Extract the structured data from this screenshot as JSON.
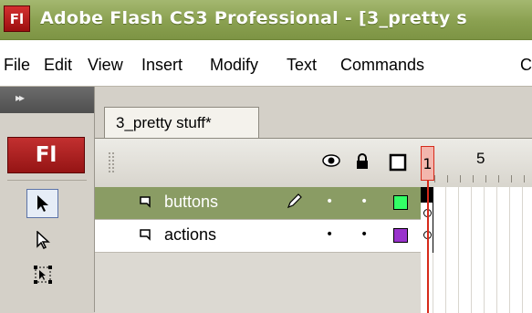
{
  "window": {
    "app_icon_text": "Fl",
    "title": "Adobe Flash CS3 Professional - [3_pretty s"
  },
  "menu": {
    "items": [
      "File",
      "Edit",
      "View",
      "Insert",
      "Modify",
      "Text",
      "Commands",
      "C"
    ]
  },
  "toolbox": {
    "collapse_glyph": "▸▸",
    "logo_text": "Fl",
    "tools": [
      "selection-tool",
      "subselection-tool",
      "free-transform-tool"
    ]
  },
  "document": {
    "tab_label": "3_pretty stuff*"
  },
  "timeline": {
    "ruler": [
      "1",
      "5"
    ],
    "current_frame": "1",
    "header_icons": [
      "eye-icon",
      "lock-icon",
      "outline-icon"
    ],
    "layers": [
      {
        "name": "buttons",
        "active": true,
        "color": "#33ff66"
      },
      {
        "name": "actions",
        "active": false,
        "color": "#9933cc"
      }
    ]
  }
}
